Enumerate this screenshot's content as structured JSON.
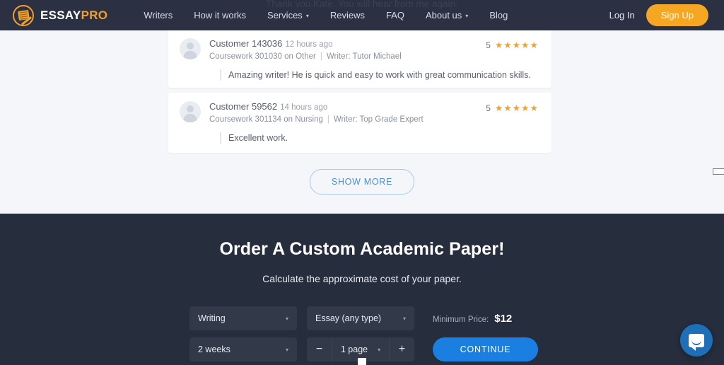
{
  "header": {
    "logo": {
      "first": "ESSAY",
      "second": "PRO",
      "icon": "essay-paper-pen-logo"
    },
    "nav": [
      {
        "label": "Writers",
        "has_caret": false
      },
      {
        "label": "How it works",
        "has_caret": false
      },
      {
        "label": "Services",
        "has_caret": true
      },
      {
        "label": "Reviews",
        "has_caret": false
      },
      {
        "label": "FAQ",
        "has_caret": false
      },
      {
        "label": "About us",
        "has_caret": true
      },
      {
        "label": "Blog",
        "has_caret": false
      }
    ],
    "login_label": "Log In",
    "signup_label": "Sign Up",
    "ghost_text": "Thank you Kate. You will hear from me again.",
    "accent_color": "#f5a623",
    "background_color": "#2b3142"
  },
  "reviews": {
    "items": [
      {
        "customer": "Customer 143036",
        "time_ago": "12 hours ago",
        "order": "Coursework 301030 on Other",
        "separator": "|",
        "writer": "Writer: Tutor Michael",
        "body": "Amazing writer! He is quick and easy to work with great communication skills.",
        "rating_value": "5",
        "stars": "★★★★★"
      },
      {
        "customer": "Customer 59562",
        "time_ago": "14 hours ago",
        "order": "Coursework 301134 on Nursing",
        "separator": "|",
        "writer": "Writer: Top Grade Expert",
        "body": "Excellent work.",
        "rating_value": "5",
        "stars": "★★★★★"
      }
    ],
    "show_more_label": "SHOW MORE",
    "star_color": "#f0a030",
    "background_color": "#f4f6f9"
  },
  "order": {
    "title": "Order A Custom Academic Paper!",
    "subtitle": "Calculate the approximate cost of your paper.",
    "background_color": "#262d3d",
    "service_select": {
      "value": "Writing",
      "caret": "▾"
    },
    "paper_type_select": {
      "value": "Essay (any type)",
      "caret": "▾"
    },
    "min_price_label": "Minimum Price:",
    "min_price_value": "$12",
    "deadline_select": {
      "value": "2 weeks",
      "caret": "▾"
    },
    "pages_stepper": {
      "minus_label": "−",
      "value": "1 page",
      "caret": "▾",
      "plus_label": "+"
    },
    "continue_label": "CONTINUE",
    "continue_color": "#1a7fe0"
  },
  "chat": {
    "icon": "chat-bubble-icon",
    "color": "#1d6fb8"
  }
}
